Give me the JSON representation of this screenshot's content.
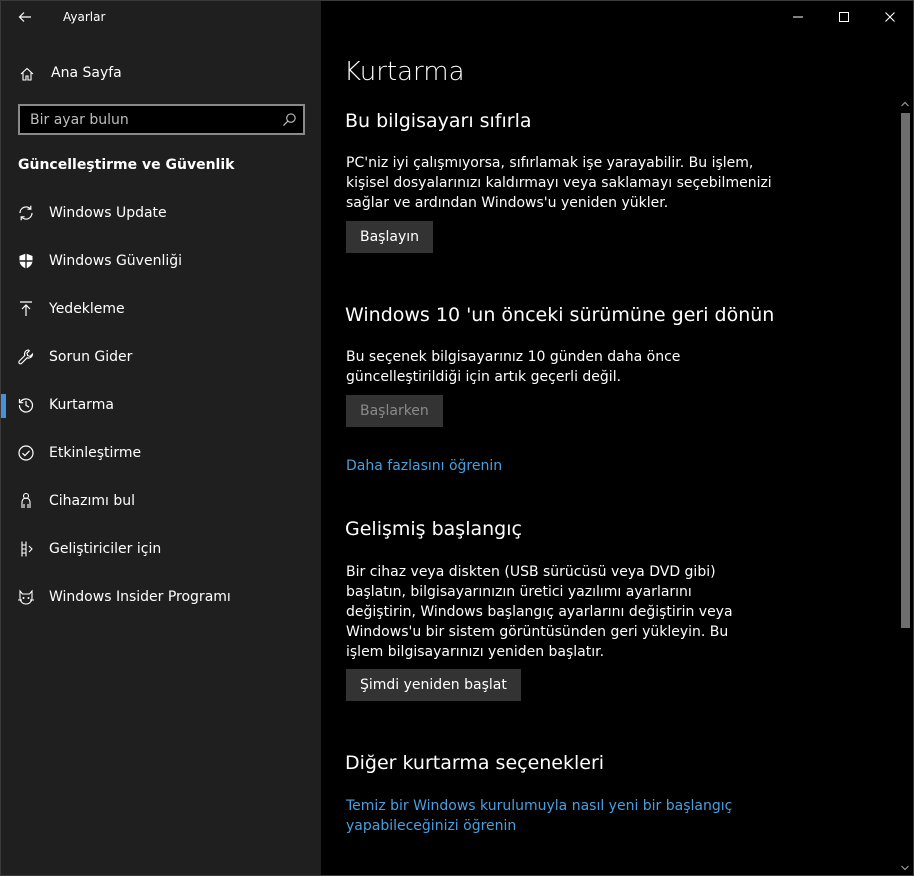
{
  "window": {
    "title": "Ayarlar",
    "controls": {
      "minimize": "minimize-icon",
      "maximize": "maximize-icon",
      "close": "close-icon"
    }
  },
  "sidebar": {
    "home_label": "Ana Sayfa",
    "search": {
      "placeholder": "Bir ayar bulun"
    },
    "section_title": "Güncelleştirme ve Güvenlik",
    "items": [
      {
        "label": "Windows Update",
        "icon": "sync-icon"
      },
      {
        "label": "Windows Güvenliği",
        "icon": "shield-icon"
      },
      {
        "label": "Yedekleme",
        "icon": "upload-arrow-icon"
      },
      {
        "label": "Sorun Gider",
        "icon": "wrench-icon"
      },
      {
        "label": "Kurtarma",
        "icon": "history-icon",
        "active": true
      },
      {
        "label": "Etkinleştirme",
        "icon": "check-circle-icon"
      },
      {
        "label": "Cihazımı bul",
        "icon": "person-location-icon"
      },
      {
        "label": "Geliştiriciler için",
        "icon": "developer-icon"
      },
      {
        "label": "Windows Insider Programı",
        "icon": "insider-cat-icon"
      }
    ],
    "accent_color": "#4a90d9"
  },
  "main": {
    "page_title": "Kurtarma",
    "reset": {
      "heading": "Bu bilgisayarı sıfırla",
      "description": "PC'niz iyi çalışmıyorsa, sıfırlamak işe yarayabilir. Bu işlem, kişisel dosyalarınızı kaldırmayı veya saklamayı seçebilmenizi sağlar ve ardından Windows'u yeniden yükler.",
      "button": "Başlayın"
    },
    "rollback": {
      "heading": "Windows 10 'un önceki sürümüne geri dönün",
      "description": "Bu seçenek bilgisayarınız 10 günden daha önce güncelleştirildiği için artık geçerli değil.",
      "button": "Başlarken",
      "link": "Daha fazlasını öğrenin"
    },
    "advanced": {
      "heading": "Gelişmiş başlangıç",
      "description": "Bir cihaz veya diskten (USB sürücüsü veya DVD gibi) başlatın, bilgisayarınızın üretici yazılımı ayarlarını değiştirin, Windows başlangıç ayarlarını değiştirin veya Windows'u bir sistem görüntüsünden geri yükleyin. Bu işlem bilgisayarınızı yeniden başlatır.",
      "button": "Şimdi yeniden başlat"
    },
    "more": {
      "heading": "Diğer kurtarma seçenekleri",
      "link": "Temiz bir Windows kurulumuyla nasıl yeni bir başlangıç yapabileceğinizi öğrenin"
    },
    "link_color": "#4a9fe0"
  }
}
